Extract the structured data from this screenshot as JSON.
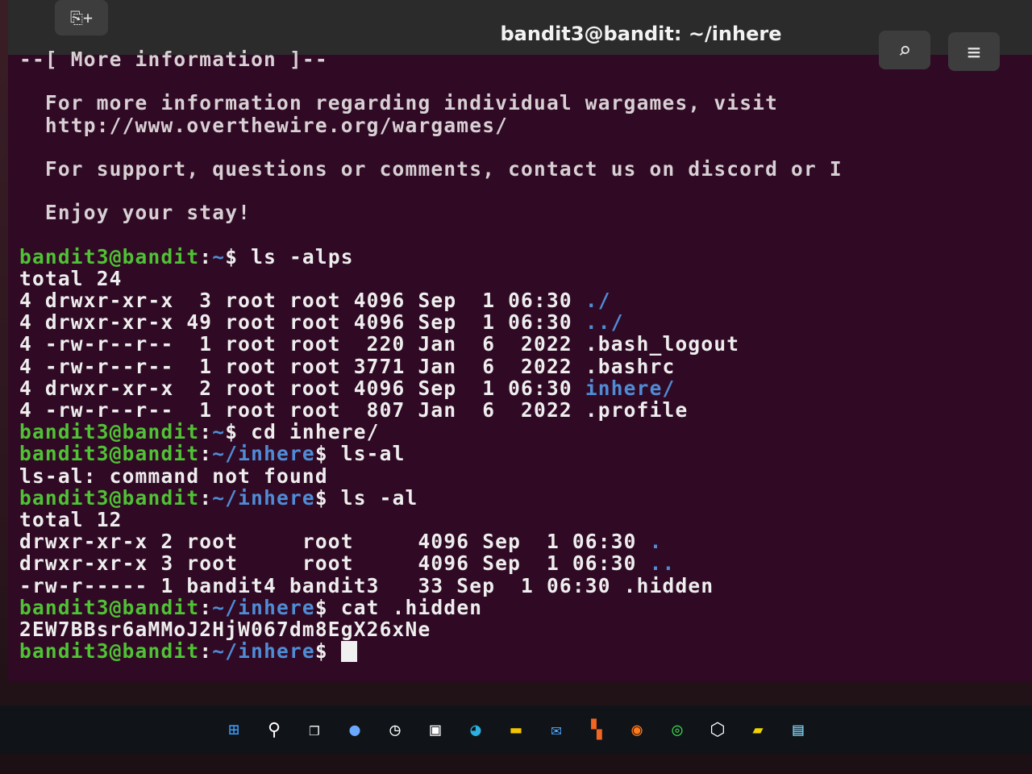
{
  "window": {
    "title": "bandit3@bandit: ~/inhere",
    "new_tab_label": "⎘+",
    "search_label": "⌕",
    "menu_label": "≡"
  },
  "motd": [
    "--[ More information ]--",
    "",
    "  For more information regarding individual wargames, visit",
    "  http://www.overthewire.org/wargames/",
    "",
    "  For support, questions or comments, contact us on discord or I",
    "",
    "  Enjoy your stay!",
    ""
  ],
  "session": [
    {
      "type": "prompt",
      "user": "bandit3@bandit",
      "sep": ":",
      "path": "~",
      "sym": "$ ",
      "cmd": "ls -alps"
    },
    {
      "type": "out",
      "text": "total 24"
    },
    {
      "type": "ls",
      "pre": "4 drwxr-xr-x  3 root root 4096 Sep  1 06:30 ",
      "name": "./",
      "cls": "dir"
    },
    {
      "type": "ls",
      "pre": "4 drwxr-xr-x 49 root root 4096 Sep  1 06:30 ",
      "name": "../",
      "cls": "dir"
    },
    {
      "type": "ls",
      "pre": "4 -rw-r--r--  1 root root  220 Jan  6  2022 ",
      "name": ".bash_logout",
      "cls": "cmd"
    },
    {
      "type": "ls",
      "pre": "4 -rw-r--r--  1 root root 3771 Jan  6  2022 ",
      "name": ".bashrc",
      "cls": "cmd"
    },
    {
      "type": "ls",
      "pre": "4 drwxr-xr-x  2 root root 4096 Sep  1 06:30 ",
      "name": "inhere/",
      "cls": "dir"
    },
    {
      "type": "ls",
      "pre": "4 -rw-r--r--  1 root root  807 Jan  6  2022 ",
      "name": ".profile",
      "cls": "cmd"
    },
    {
      "type": "prompt",
      "user": "bandit3@bandit",
      "sep": ":",
      "path": "~",
      "sym": "$ ",
      "cmd": "cd inhere/"
    },
    {
      "type": "prompt",
      "user": "bandit3@bandit",
      "sep": ":",
      "path": "~/inhere",
      "sym": "$ ",
      "cmd": "ls-al"
    },
    {
      "type": "out",
      "text": "ls-al: command not found"
    },
    {
      "type": "prompt",
      "user": "bandit3@bandit",
      "sep": ":",
      "path": "~/inhere",
      "sym": "$ ",
      "cmd": "ls -al"
    },
    {
      "type": "out",
      "text": "total 12"
    },
    {
      "type": "ls",
      "pre": "drwxr-xr-x 2 root     root     4096 Sep  1 06:30 ",
      "name": ".",
      "cls": "dir"
    },
    {
      "type": "ls",
      "pre": "drwxr-xr-x 3 root     root     4096 Sep  1 06:30 ",
      "name": "..",
      "cls": "dir"
    },
    {
      "type": "ls",
      "pre": "-rw-r----- 1 bandit4 bandit3   33 Sep  1 06:30 ",
      "name": ".hidden",
      "cls": "cmd"
    },
    {
      "type": "prompt",
      "user": "bandit3@bandit",
      "sep": ":",
      "path": "~/inhere",
      "sym": "$ ",
      "cmd": "cat .hidden"
    },
    {
      "type": "out",
      "text": "2EW7BBsr6aMMoJ2HjW067dm8EgX26xNe"
    },
    {
      "type": "prompt",
      "user": "bandit3@bandit",
      "sep": ":",
      "path": "~/inhere",
      "sym": "$ ",
      "cmd": "",
      "cursor": true
    }
  ],
  "taskbar": [
    {
      "name": "start-icon",
      "glyph": "⊞",
      "color": "#3aa0ff"
    },
    {
      "name": "search-icon",
      "glyph": "⚲",
      "color": "#ffffff"
    },
    {
      "name": "task-view-icon",
      "glyph": "❐",
      "color": "#ffffff"
    },
    {
      "name": "chat-icon",
      "glyph": "●",
      "color": "#6aa7ff"
    },
    {
      "name": "clock-icon",
      "glyph": "◷",
      "color": "#ffffff"
    },
    {
      "name": "store-icon",
      "glyph": "▣",
      "color": "#ffffff"
    },
    {
      "name": "edge-icon",
      "glyph": "◕",
      "color": "#2bb0e0"
    },
    {
      "name": "file-explorer-icon",
      "glyph": "▬",
      "color": "#f5c400"
    },
    {
      "name": "mail-icon",
      "glyph": "✉",
      "color": "#4aa8ff"
    },
    {
      "name": "office-icon",
      "glyph": "▚",
      "color": "#f26522"
    },
    {
      "name": "firefox-icon",
      "glyph": "◉",
      "color": "#ff7a1a"
    },
    {
      "name": "chrome-icon",
      "glyph": "◎",
      "color": "#3ccf4e"
    },
    {
      "name": "cube-icon",
      "glyph": "⬡",
      "color": "#ffffff"
    },
    {
      "name": "explorer-active-icon",
      "glyph": "▰",
      "color": "#f2d200"
    },
    {
      "name": "notepad-icon",
      "glyph": "▤",
      "color": "#7fd3f7"
    }
  ]
}
